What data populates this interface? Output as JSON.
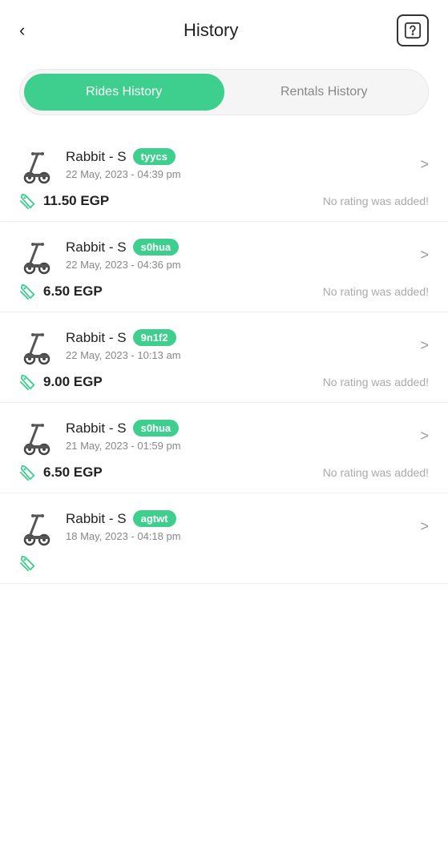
{
  "header": {
    "back_label": "<",
    "title": "History",
    "help_icon": "?"
  },
  "tabs": [
    {
      "id": "rides",
      "label": "Rides History",
      "active": true
    },
    {
      "id": "rentals",
      "label": "Rentals History",
      "active": false
    }
  ],
  "rides": [
    {
      "vehicle": "Rabbit - S",
      "code": "tyycs",
      "date": "22 May, 2023 - 04:39 pm",
      "price": "11.50 EGP",
      "rating_text": "No rating was added!"
    },
    {
      "vehicle": "Rabbit - S",
      "code": "s0hua",
      "date": "22 May, 2023 - 04:36 pm",
      "price": "6.50 EGP",
      "rating_text": "No rating was added!"
    },
    {
      "vehicle": "Rabbit - S",
      "code": "9n1f2",
      "date": "22 May, 2023 - 10:13 am",
      "price": "9.00 EGP",
      "rating_text": "No rating was added!"
    },
    {
      "vehicle": "Rabbit - S",
      "code": "s0hua",
      "date": "21 May, 2023 - 01:59 pm",
      "price": "6.50 EGP",
      "rating_text": "No rating was added!"
    },
    {
      "vehicle": "Rabbit - S",
      "code": "agtwt",
      "date": "18 May, 2023 - 04:18 pm",
      "price": "...",
      "rating_text": ""
    }
  ],
  "colors": {
    "green": "#3ecf8e",
    "text_primary": "#222",
    "text_secondary": "#888",
    "divider": "#eee"
  }
}
